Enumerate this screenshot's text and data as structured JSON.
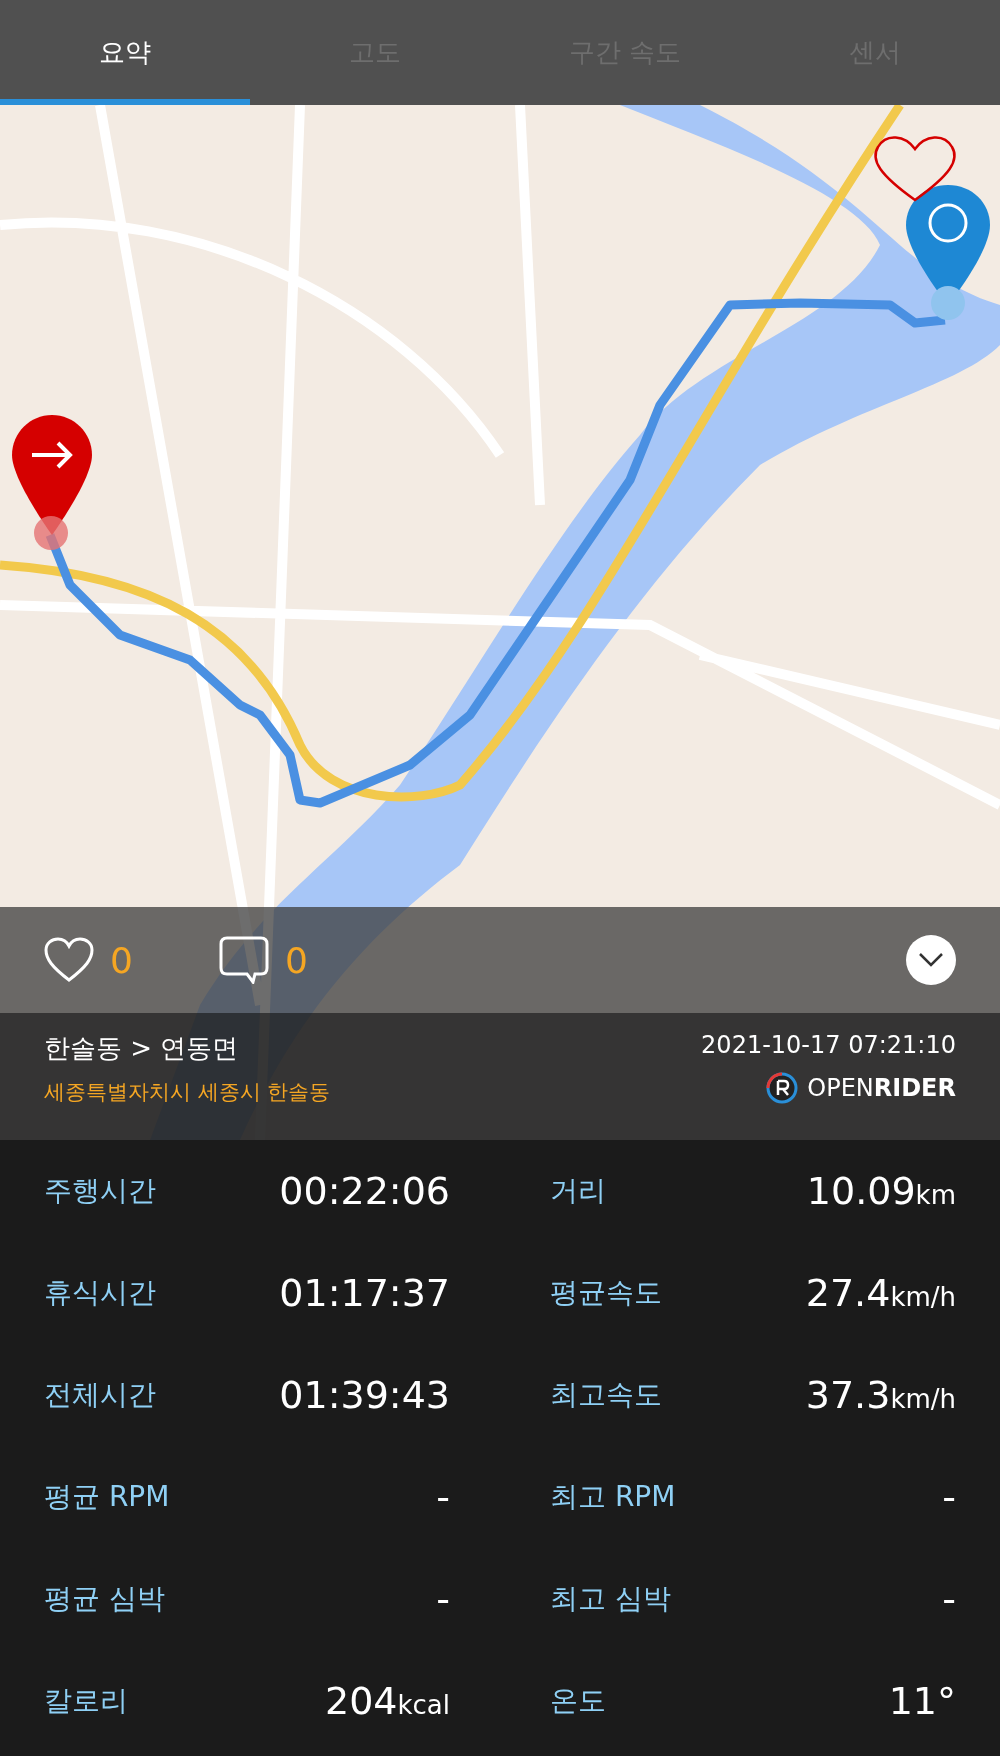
{
  "tabs": [
    {
      "label": "요약",
      "selected": true
    },
    {
      "label": "고도",
      "selected": false
    },
    {
      "label": "구간 속도",
      "selected": false
    },
    {
      "label": "센서",
      "selected": false
    }
  ],
  "social": {
    "likes": "0",
    "comments": "0"
  },
  "ride": {
    "route": "한솔동 > 연동면",
    "address": "세종특별자치시 세종시 한솔동",
    "datetime": "2021-10-17 07:21:10",
    "brand": "OPEN**RIDER**"
  },
  "stats": [
    {
      "label": "주행시간",
      "value": "00:22:06"
    },
    {
      "label": "거리",
      "value": "10.09",
      "unit": "km"
    },
    {
      "label": "휴식시간",
      "value": "01:17:37"
    },
    {
      "label": "평균속도",
      "value": "27.4",
      "unit": "km/h"
    },
    {
      "label": "전체시간",
      "value": "01:39:43"
    },
    {
      "label": "최고속도",
      "value": "37.3",
      "unit": "km/h"
    },
    {
      "label": "평균 RPM",
      "value": "-"
    },
    {
      "label": "최고 RPM",
      "value": "-"
    },
    {
      "label": "평균 심박",
      "value": "-"
    },
    {
      "label": "최고 심박",
      "value": "-"
    },
    {
      "label": "칼로리",
      "value": "204",
      "unit": "kcal"
    },
    {
      "label": "온도",
      "value": "11°"
    }
  ]
}
